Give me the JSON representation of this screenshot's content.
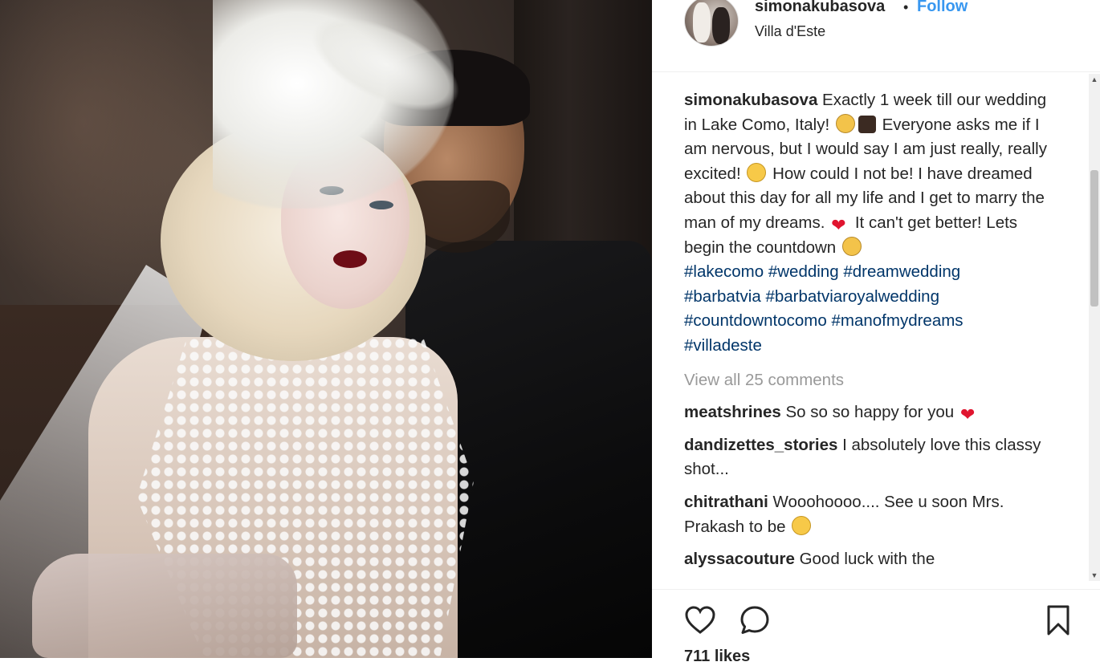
{
  "post": {
    "owner": "simonakubasova",
    "dot": "•",
    "follow_label": "Follow",
    "location": "Villa d'Este"
  },
  "caption": {
    "author": "simonakubasova",
    "text_1": "Exactly 1 week till our wedding in Lake Como, Italy!",
    "text_2": "Everyone asks me if I am nervous, but I would say I am just really, really excited!",
    "text_3": "How could I not be! I have dreamed about this day for all my life and I get to marry the man of my dreams.",
    "text_4": "It can't get better! Lets begin the countdown",
    "hashtags": [
      "#lakecomo",
      "#wedding",
      "#dreamwedding",
      "#barbatvia",
      "#barbatviaroyalwedding",
      "#countdowntocomo",
      "#manofmydreams",
      "#villadeste"
    ]
  },
  "view_all_comments": "View all 25 comments",
  "comments": [
    {
      "user": "meatshrines",
      "text": "So so so happy for you"
    },
    {
      "user": "dandizettes_stories",
      "text": "I absolutely love this classy shot..."
    },
    {
      "user": "chitrathani",
      "text": "Wooohoooo.... See u soon Mrs. Prakash to be"
    },
    {
      "user": "alyssacouture",
      "text": "Good luck with the"
    }
  ],
  "actions": {
    "like_icon": "heart-outline-icon",
    "comment_icon": "comment-bubble-icon",
    "save_icon": "bookmark-icon"
  },
  "likes": "711 likes",
  "colors": {
    "link_blue": "#3897f0",
    "hashtag_blue": "#003569",
    "text": "#262626",
    "muted": "#999999",
    "heart_red": "#e0152f"
  }
}
